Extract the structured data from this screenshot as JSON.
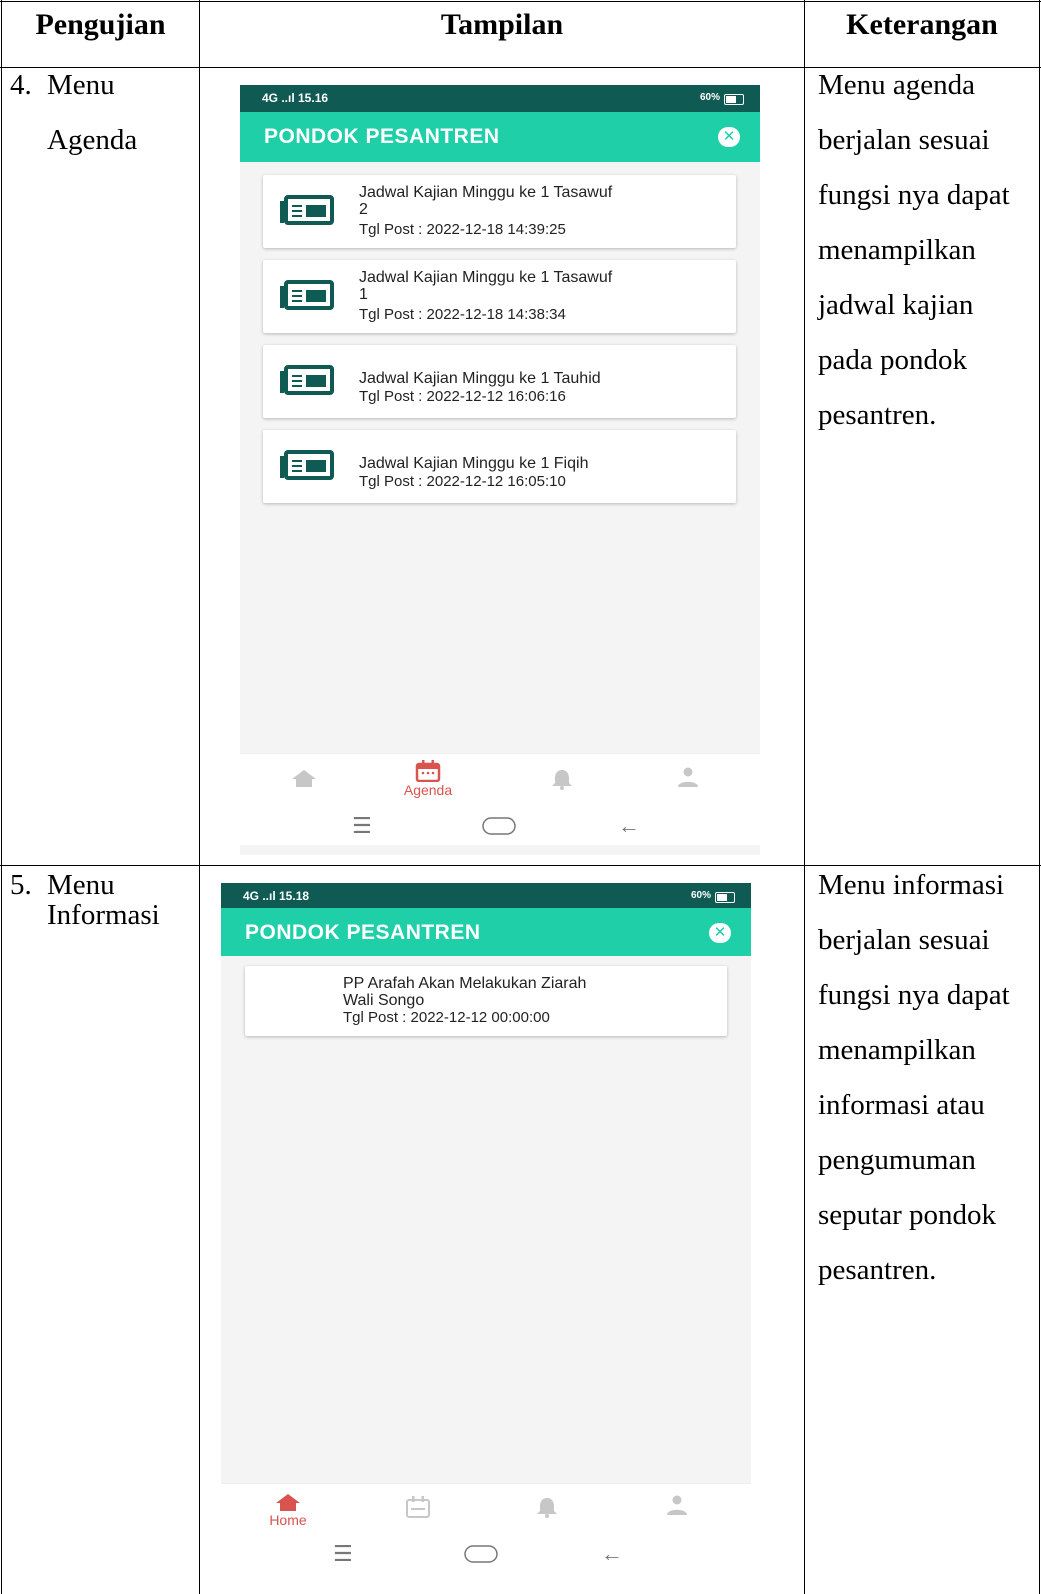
{
  "table": {
    "headers": [
      "Pengujian",
      "Tampilan",
      "Keterangan"
    ]
  },
  "rows": [
    {
      "number": "4.",
      "test_line1": "Menu",
      "test_line2": "Agenda",
      "description_lines": [
        "Menu agenda",
        "berjalan sesuai",
        "fungsi nya dapat",
        "menampilkan",
        "jadwal kajian",
        "pada pondok",
        "pesantren."
      ],
      "phone": {
        "status_left": "4G ..ıl 15.16",
        "status_right": "60%",
        "app_title": "PONDOK PESANTREN",
        "cards": [
          {
            "title_line1": "Jadwal Kajian Minggu  ke 1 Tasawuf",
            "title_line2": "2",
            "post": "Tgl Post : 2022-12-18 14:39:25"
          },
          {
            "title_line1": "Jadwal Kajian Minggu  ke 1 Tasawuf",
            "title_line2": "1",
            "post": "Tgl Post : 2022-12-18 14:38:34"
          },
          {
            "title_line1": "Jadwal Kajian Minggu  ke 1 Tauhid",
            "title_line2": "",
            "post": "Tgl Post : 2022-12-12 16:06:16"
          },
          {
            "title_line1": "Jadwal Kajian Minggu  ke 1 Fiqih",
            "title_line2": "",
            "post": "Tgl Post : 2022-12-12 16:05:10"
          }
        ],
        "nav_active_label": "Agenda"
      }
    },
    {
      "number": "5.",
      "test_line1": "Menu",
      "test_line2": "Informasi",
      "description_lines": [
        "Menu informasi",
        "berjalan sesuai",
        "fungsi nya dapat",
        "menampilkan",
        "informasi atau",
        "pengumuman",
        "seputar pondok",
        "pesantren."
      ],
      "phone": {
        "status_left": "4G ..ıl 15.18",
        "status_right": "60%",
        "app_title": "PONDOK PESANTREN",
        "cards": [
          {
            "title_line1": "PP Arafah Akan Melakukan Ziarah",
            "title_line2": "Wali Songo",
            "post": "Tgl Post : 2022-12-12 00:00:00"
          }
        ],
        "nav_active_label": "Home"
      }
    }
  ],
  "icons": {
    "close": "close-circle-icon",
    "news": "newspaper-icon",
    "home": "home-icon",
    "calendar": "calendar-icon",
    "bell": "bell-icon",
    "user": "user-icon"
  },
  "colors": {
    "status_bar": "#0f5a52",
    "app_bar": "#1ecfa8",
    "nav_active": "#d9534f",
    "news_icon": "#0f5a52"
  }
}
